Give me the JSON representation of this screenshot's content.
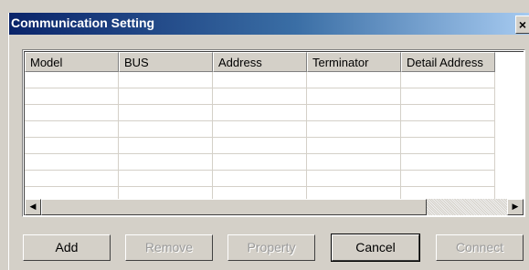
{
  "window": {
    "title": "Communication Setting",
    "close_label": "×"
  },
  "table": {
    "columns": [
      "Model",
      "BUS",
      "Address",
      "Terminator",
      "Detail Address"
    ],
    "rows": []
  },
  "scrollbar": {
    "left_arrow": "◀",
    "right_arrow": "▶"
  },
  "buttons": {
    "add": "Add",
    "remove": "Remove",
    "property": "Property",
    "cancel": "Cancel",
    "connect": "Connect"
  }
}
